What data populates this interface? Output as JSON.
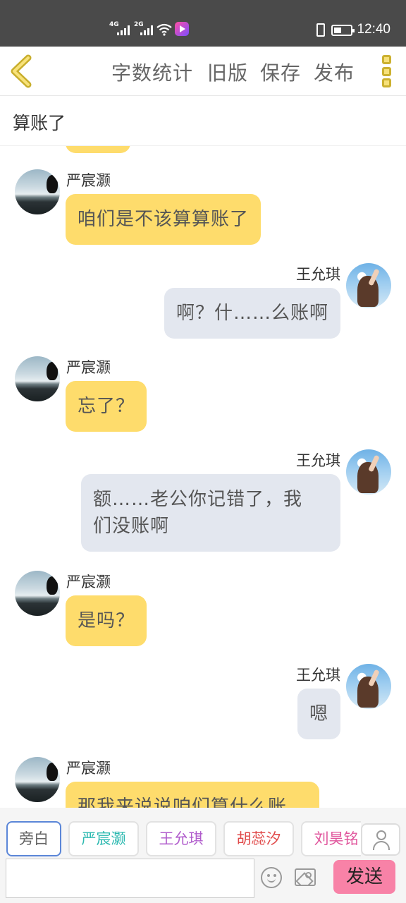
{
  "status_bar": {
    "net1": "4G",
    "net2": "2G",
    "time": "12:40"
  },
  "toolbar": {
    "word_count": "字数统计",
    "old_version": "旧版",
    "save": "保存",
    "publish": "发布"
  },
  "chapter_title": "算账了",
  "messages": [
    {
      "side": "left",
      "name": "严宸灏",
      "text": "咱们是不该算算账了"
    },
    {
      "side": "right",
      "name": "王允琪",
      "text": "啊？什……么账啊"
    },
    {
      "side": "left",
      "name": "严宸灏",
      "text": "忘了？"
    },
    {
      "side": "right",
      "name": "王允琪",
      "text": "额……老公你记错了，我们没账啊",
      "line1": "额……老公你记错了，我",
      "line2": "们没账啊"
    },
    {
      "side": "left",
      "name": "严宸灏",
      "text": "是吗？"
    },
    {
      "side": "right",
      "name": "王允琪",
      "text": "嗯"
    },
    {
      "side": "left",
      "name": "严宸灏",
      "text": "那我来说说咱们算什么账"
    }
  ],
  "roles": [
    {
      "label": "旁白",
      "color": "#666666"
    },
    {
      "label": "严宸灏",
      "color": "#2cb9b0"
    },
    {
      "label": "王允琪",
      "color": "#b05ccc"
    },
    {
      "label": "胡蕊汐",
      "color": "#e04848"
    },
    {
      "label": "刘昊铭",
      "color": "#e0559c"
    }
  ],
  "input": {
    "value": "",
    "send_label": "发送"
  },
  "icons": {
    "back": "chevron-left-icon",
    "more": "more-vertical-icon",
    "person": "person-icon",
    "emoji": "emoji-icon",
    "image": "image-icon"
  },
  "colors": {
    "left_bubble": "#fedc6c",
    "right_bubble": "#e3e7ef",
    "send_button": "#f882a7",
    "accent": "#f7e17a"
  }
}
